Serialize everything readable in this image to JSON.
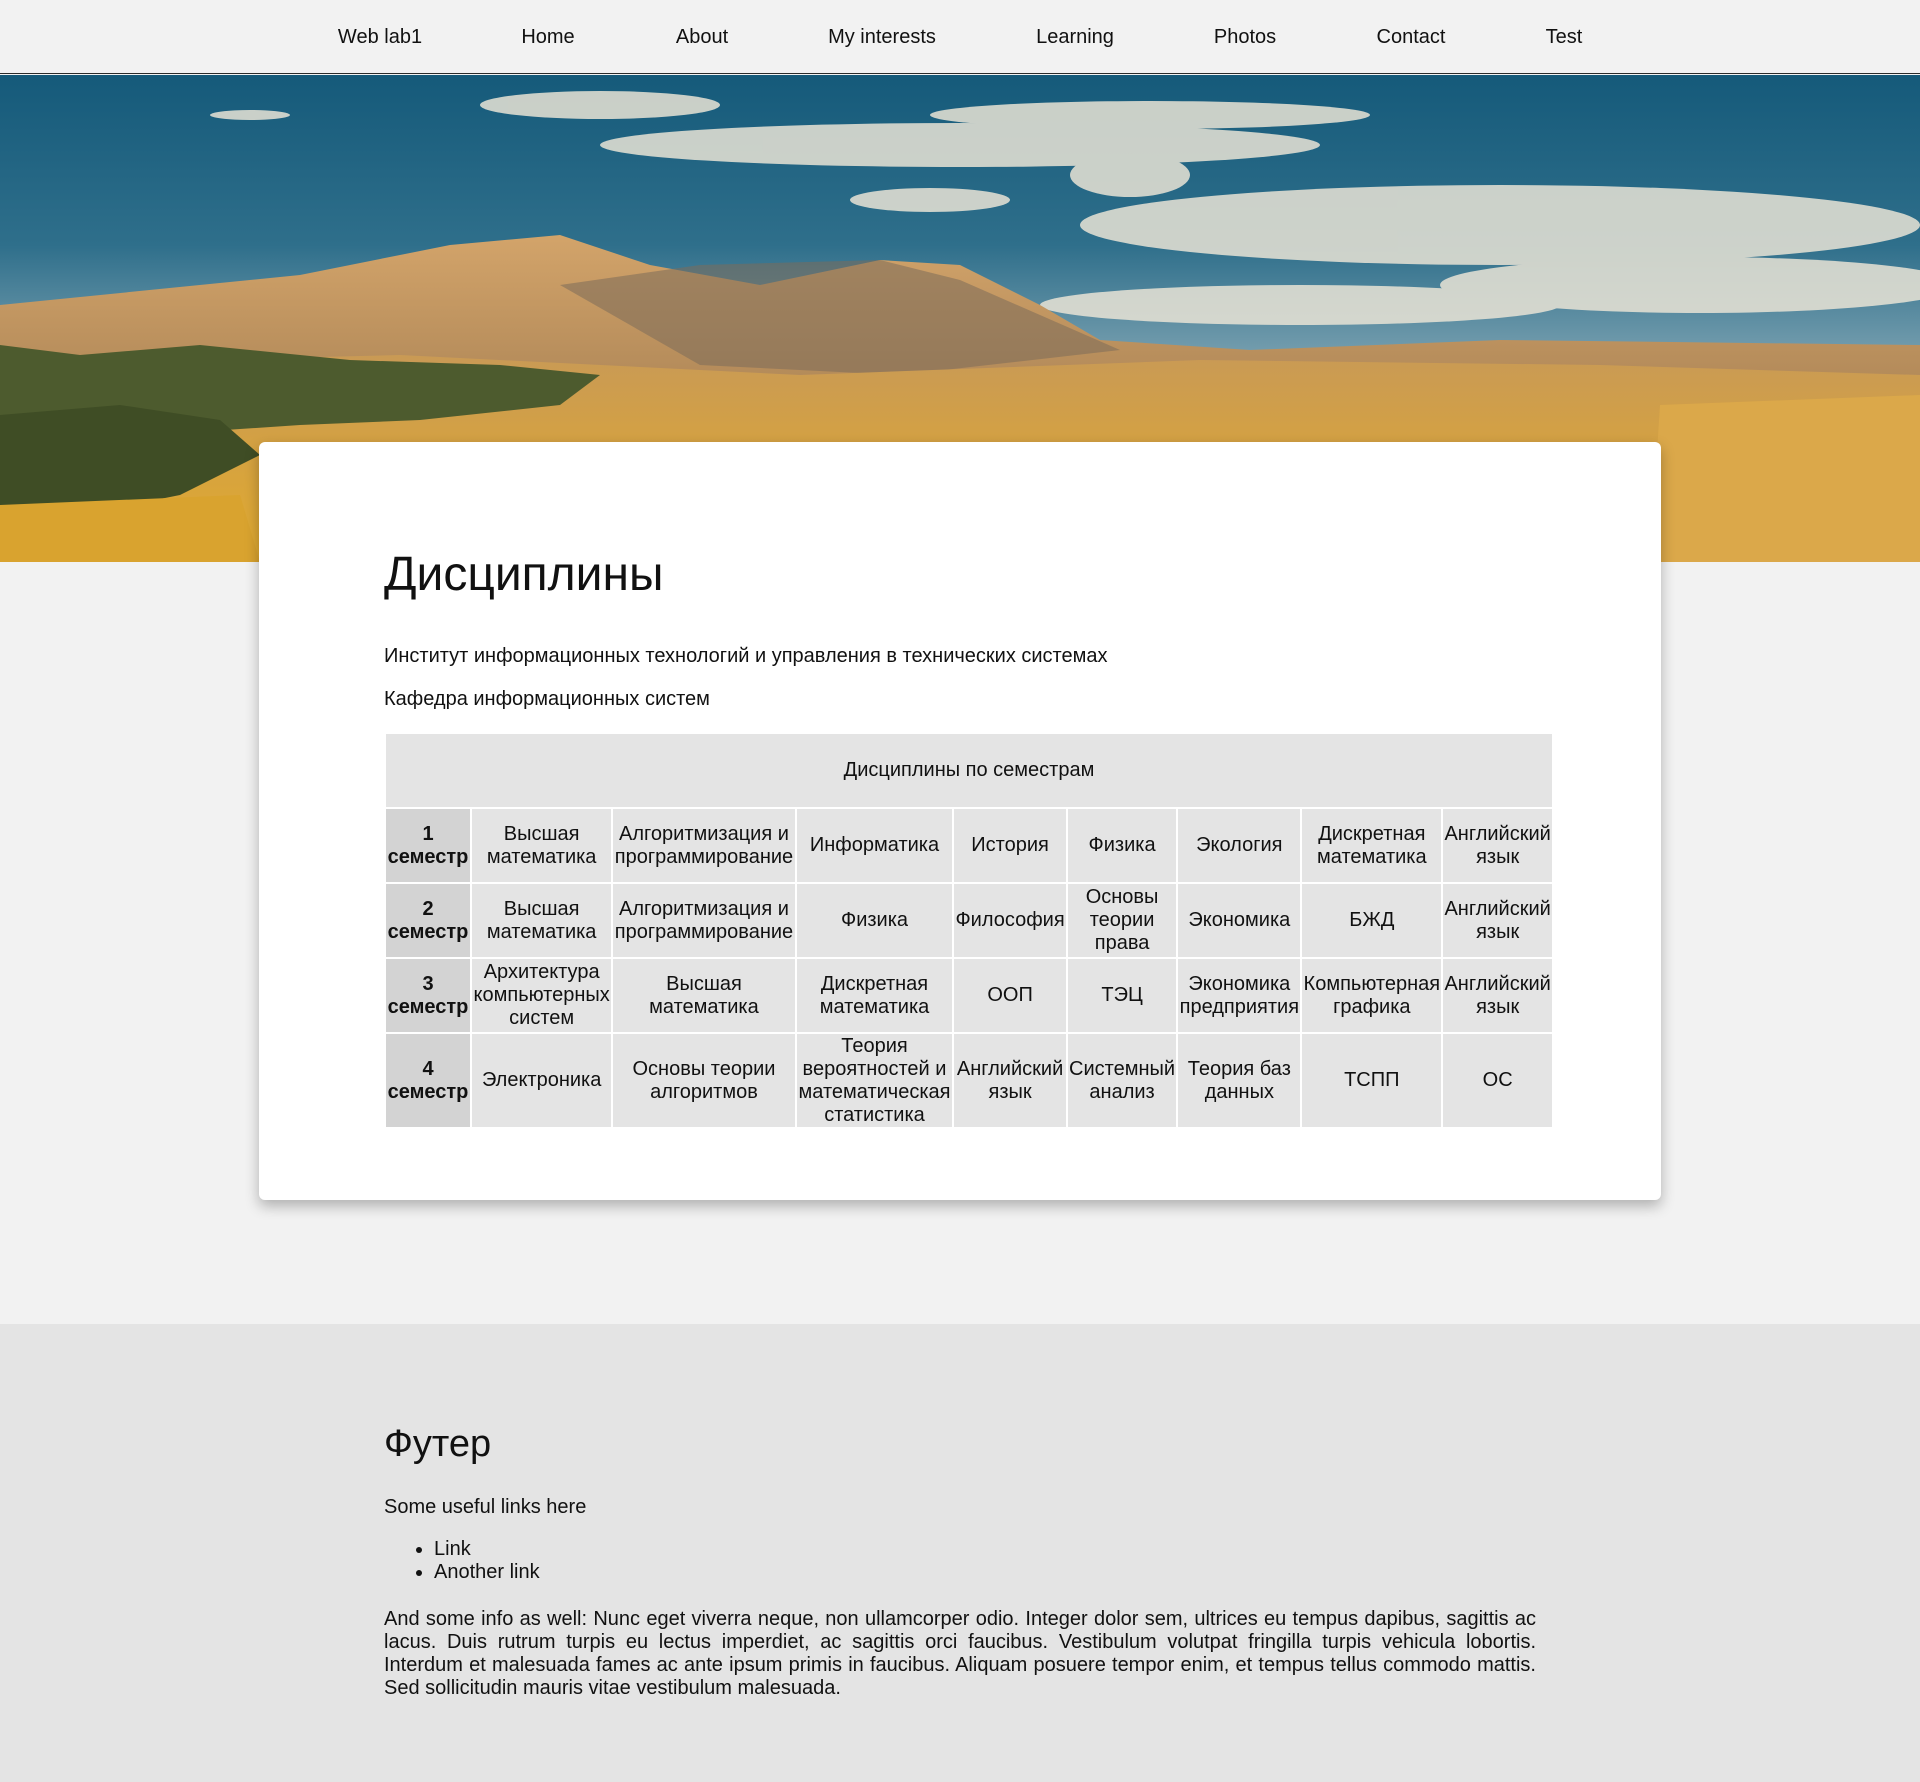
{
  "nav": {
    "items": [
      "Web lab1",
      "Home",
      "About",
      "My interests",
      "Learning",
      "Photos",
      "Contact",
      "Test"
    ]
  },
  "hero": {
    "image": "mountain-landscape-photo"
  },
  "main": {
    "title": "Дисциплины",
    "institute": "Институт информационных технологий и управления в технических системах",
    "department": "Кафедра информационных систем",
    "table": {
      "caption": "Дисциплины по семестрам",
      "rows": [
        {
          "semester": "1 семестр",
          "cells": [
            "Высшая математика",
            "Алгоритмизация и программирование",
            "Информатика",
            "История",
            "Физика",
            "Экология",
            "Дискретная математика",
            "Английский язык"
          ]
        },
        {
          "semester": "2 семестр",
          "cells": [
            "Высшая математика",
            "Алгоритмизация и программирование",
            "Физика",
            "Философия",
            "Основы теории права",
            "Экономика",
            "БЖД",
            "Английский язык"
          ]
        },
        {
          "semester": "3 семестр",
          "cells": [
            "Архитектура компьютерных систем",
            "Высшая математика",
            "Дискретная математика",
            "ООП",
            "ТЭЦ",
            "Экономика предприятия",
            "Компьютерная графика",
            "Английский язык"
          ]
        },
        {
          "semester": "4 семестр",
          "cells": [
            "Электроника",
            "Основы теории алгоритмов",
            "Теория вероятностей и математическая статистика",
            "Английский язык",
            "Системный анализ",
            "Теория баз данных",
            "ТСПП",
            "ОС"
          ]
        }
      ]
    }
  },
  "footer": {
    "title": "Футер",
    "subtitle": "Some useful links here",
    "links": [
      "Link",
      "Another link"
    ],
    "info": "And some info as well: Nunc eget viverra neque, non ullamcorper odio. Integer dolor sem, ultrices eu tempus dapibus, sagittis ac lacus. Duis rutrum turpis eu lectus imperdiet, ac sagittis orci faucibus. Vestibulum volutpat fringilla turpis vehicula lobortis. Interdum et malesuada fames ac ante ipsum primis in faucibus. Aliquam posuere tempor enim, et tempus tellus commodo mattis. Sed sollicitudin mauris vitae vestibulum malesuada."
  }
}
